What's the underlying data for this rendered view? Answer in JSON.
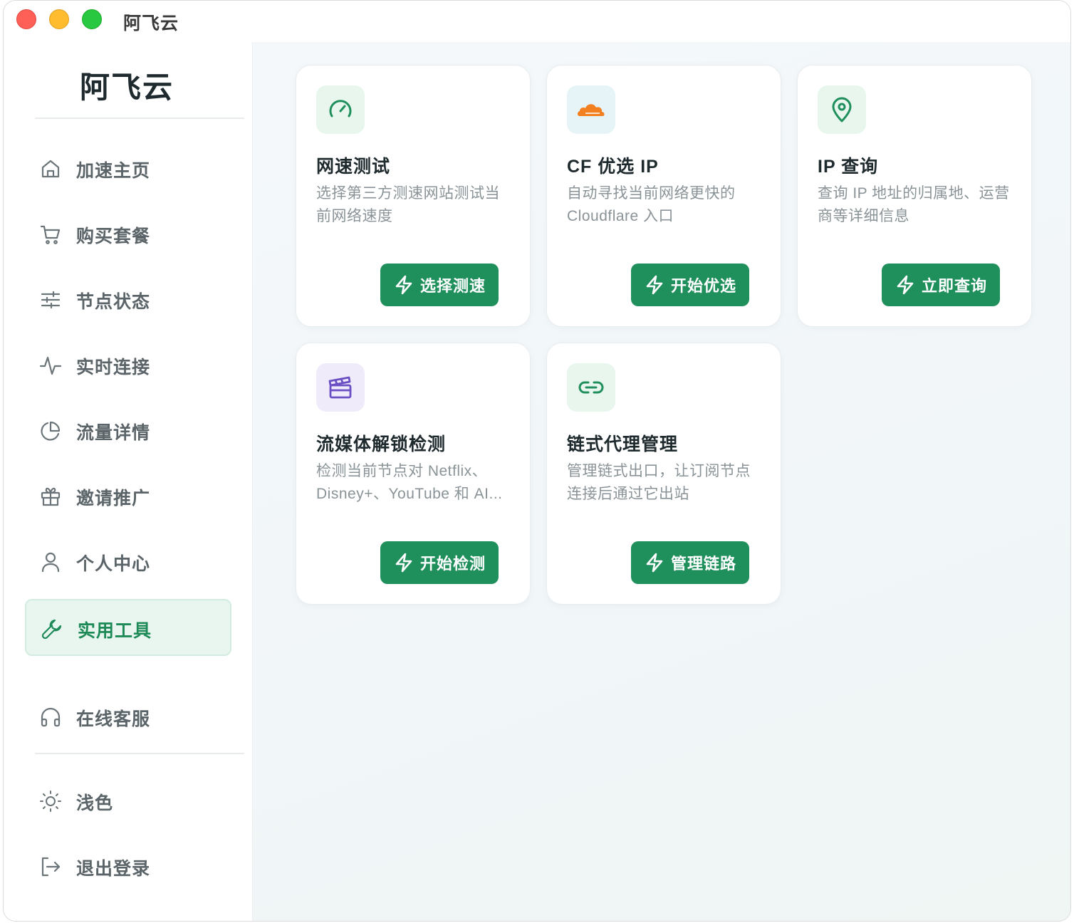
{
  "window": {
    "title": "阿飞云"
  },
  "sidebar": {
    "brand": "阿飞云",
    "items": [
      {
        "label": "加速主页",
        "icon": "home-icon"
      },
      {
        "label": "购买套餐",
        "icon": "cart-icon"
      },
      {
        "label": "节点状态",
        "icon": "sliders-icon"
      },
      {
        "label": "实时连接",
        "icon": "activity-icon"
      },
      {
        "label": "流量详情",
        "icon": "pie-chart-icon"
      },
      {
        "label": "邀请推广",
        "icon": "gift-icon"
      },
      {
        "label": "个人中心",
        "icon": "user-icon"
      },
      {
        "label": "实用工具",
        "icon": "wrench-icon",
        "active": true
      },
      {
        "label": "在线客服",
        "icon": "headphones-icon"
      }
    ],
    "bottom": [
      {
        "label": "浅色",
        "icon": "sun-icon"
      },
      {
        "label": "退出登录",
        "icon": "logout-icon"
      }
    ]
  },
  "tools": [
    {
      "title": "网速测试",
      "desc": "选择第三方测速网站测试当前网络速度",
      "button": "选择测速",
      "icon": "speedometer-icon"
    },
    {
      "title": "CF 优选 IP",
      "desc": "自动寻找当前网络更快的 Cloudflare 入口",
      "button": "开始优选",
      "icon": "cloudflare-icon"
    },
    {
      "title": "IP 查询",
      "desc": "查询 IP 地址的归属地、运营商等详细信息",
      "button": "立即查询",
      "icon": "map-pin-icon"
    },
    {
      "title": "流媒体解锁检测",
      "desc": "检测当前节点对 Netflix、Disney+、YouTube 和 AI...",
      "button": "开始检测",
      "icon": "clapperboard-icon"
    },
    {
      "title": "链式代理管理",
      "desc": "管理链式出口，让订阅节点连接后通过它出站",
      "button": "管理链路",
      "icon": "link-icon"
    }
  ],
  "colors": {
    "accent": "#1f8f5c",
    "active_bg": "#e9f6ef",
    "text_dark": "#1f2a2e",
    "text_muted": "#8a9397"
  }
}
